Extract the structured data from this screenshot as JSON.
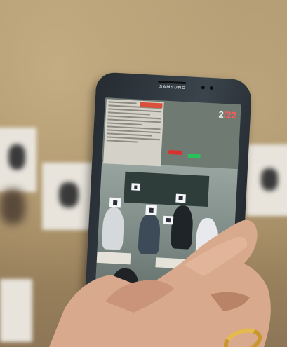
{
  "phone": {
    "brand": "SAMSUNG",
    "counter_main": "2",
    "counter_accent": "/22"
  },
  "colors": {
    "wall": "#b39b72",
    "phone_body": "#2e353b",
    "ar_tag": "#d9513a",
    "button_red": "#d8332b",
    "button_green": "#27c35a",
    "ring_gold": "#c9972e",
    "skin": "#d8a98c"
  },
  "icons": {
    "camera": "front-camera-icon"
  }
}
